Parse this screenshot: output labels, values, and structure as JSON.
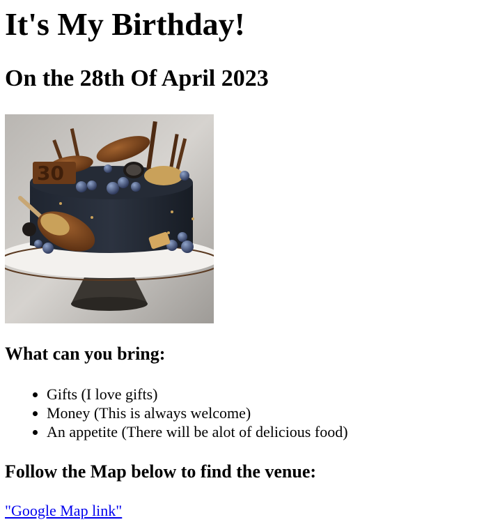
{
  "heading": "It's My Birthday!",
  "date_heading": "On the 28th Of April 2023",
  "image": {
    "cake_digits": "30"
  },
  "bring_section": {
    "title": "What can you bring:",
    "items": [
      "Gifts (I love gifts)",
      "Money (This is always welcome)",
      "An appetite (There will be alot of delicious food)"
    ]
  },
  "map_section": {
    "title": "Follow the Map below to find the venue:",
    "link_label": "\"Google Map link\""
  },
  "colors": {
    "link": "#0000ee",
    "text": "#000000"
  }
}
